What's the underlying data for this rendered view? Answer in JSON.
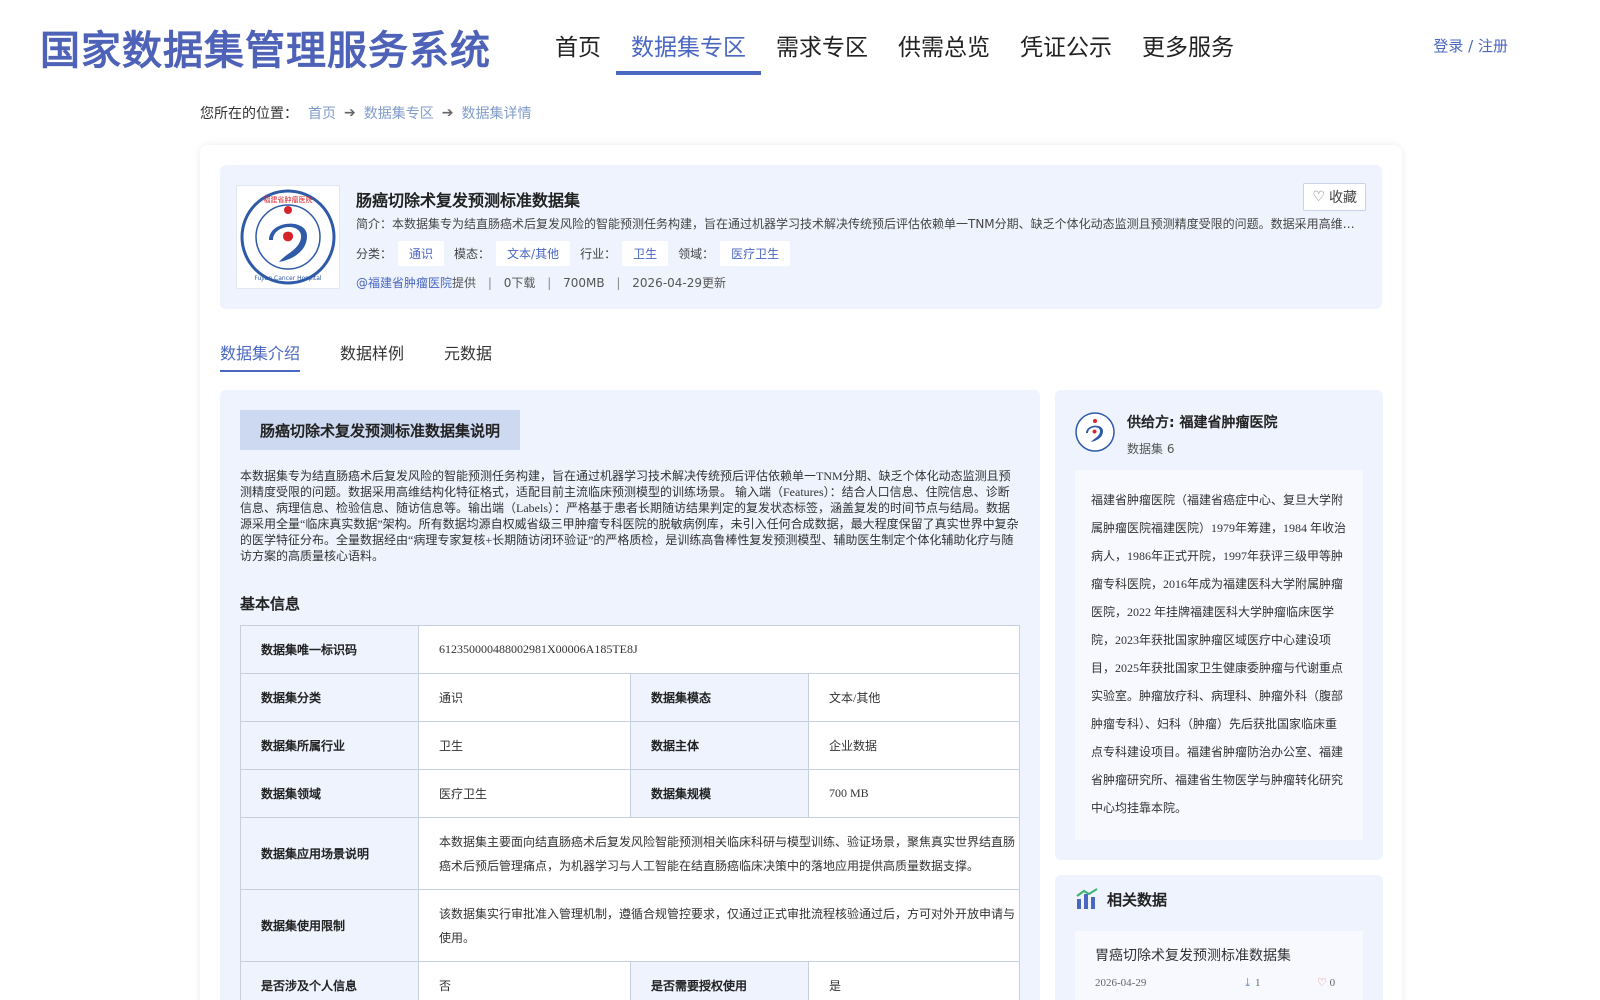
{
  "header": {
    "logo": "国家数据集管理服务系统",
    "nav": [
      "首页",
      "数据集专区",
      "需求专区",
      "供需总览",
      "凭证公示",
      "更多服务"
    ],
    "active_nav": "数据集专区",
    "login": "登录 / 注册"
  },
  "breadcrumb": {
    "label": "您所在的位置：",
    "items": [
      "首页",
      "数据集专区",
      "数据集详情"
    ]
  },
  "dataset": {
    "title": "肠癌切除术复发预测标准数据集",
    "brief": "简介：本数据集专为结直肠癌术后复发风险的智能预测任务构建，旨在通过机器学习技术解决传统预后评估依赖单一TNM分期、缺乏个体化动态监测且预测精度受限的问题。数据采用高维…",
    "favorite": "收藏",
    "tags": {
      "category_label": "分类：",
      "category": "通识",
      "modality_label": "模态：",
      "modality": "文本/其他",
      "industry_label": "行业：",
      "industry": "卫生",
      "domain_label": "领域：",
      "domain": "医疗卫生"
    },
    "meta": {
      "provider": "@福建省肿瘤医院",
      "provider_suffix": "提供",
      "downloads": "0下载",
      "size": "700MB",
      "updated": "2026-04-29更新"
    },
    "logo_text_top": "福建省肿瘤医院",
    "logo_text_bottom": "Fujian Cancer Hospital"
  },
  "tabs": [
    "数据集介绍",
    "数据样例",
    "元数据"
  ],
  "intro": {
    "banner": "肠癌切除术复发预测标准数据集说明",
    "description": "本数据集专为结直肠癌术后复发风险的智能预测任务构建，旨在通过机器学习技术解决传统预后评估依赖单一TNM分期、缺乏个体化动态监测且预测精度受限的问题。数据采用高维结构化特征格式，适配目前主流临床预测模型的训练场景。 输入端（Features）：结合人口信息、住院信息、诊断信息、病理信息、检验信息、随访信息等。输出端（Labels）：严格基于患者长期随访结果判定的复发状态标签，涵盖复发的时间节点与结局。数据源采用全量“临床真实数据”架构。所有数据均源自权威省级三甲肿瘤专科医院的脱敏病例库，未引入任何合成数据，最大程度保留了真实世界中复杂的医学特征分布。全量数据经由“病理专家复核+长期随访闭环验证”的严格质检，是训练高鲁棒性复发预测模型、辅助医生制定个体化辅助化疗与随访方案的高质量核心语料。",
    "basic_title": "基本信息",
    "table": {
      "uid_k": "数据集唯一标识码",
      "uid_v": "612350000488002981X00006A185TE8J",
      "cat_k": "数据集分类",
      "cat_v": "通识",
      "mod_k": "数据集模态",
      "mod_v": "文本/其他",
      "ind_k": "数据集所属行业",
      "ind_v": "卫生",
      "subj_k": "数据主体",
      "subj_v": "企业数据",
      "dom_k": "数据集领域",
      "dom_v": "医疗卫生",
      "scale_k": "数据集规模",
      "scale_v": "700 MB",
      "scene_k": "数据集应用场景说明",
      "scene_v": "本数据集主要面向结直肠癌术后复发风险智能预测相关临床科研与模型训练、验证场景，聚焦真实世界结直肠癌术后预后管理痛点，为机器学习与人工智能在结直肠癌临床决策中的落地应用提供高质量数据支撑。",
      "limit_k": "数据集使用限制",
      "limit_v": "该数据集实行审批准入管理机制，遵循合规管控要求，仅通过正式审批流程核验通过后，方可对外开放申请与使用。",
      "pi_k": "是否涉及个人信息",
      "pi_v": "否",
      "auth_k": "是否需要授权使用",
      "auth_v": "是"
    }
  },
  "supplier": {
    "name": "供给方: 福建省肿瘤医院",
    "count": "数据集 6",
    "intro": "福建省肿瘤医院（福建省癌症中心、复旦大学附属肿瘤医院福建医院）1979年筹建，1984 年收治病人，1986年正式开院，1997年获评三级甲等肿瘤专科医院，2016年成为福建医科大学附属肿瘤医院，2022 年挂牌福建医科大学肿瘤临床医学院，2023年获批国家肿瘤区域医疗中心建设项目，2025年获批国家卫生健康委肿瘤与代谢重点实验室。肿瘤放疗科、病理科、肿瘤外科（腹部肿瘤专科）、妇科（肿瘤）先后获批国家临床重点专科建设项目。福建省肿瘤防治办公室、福建省肿瘤研究所、福建省生物医学与肿瘤转化研究中心均挂靠本院。"
  },
  "related": {
    "title": "相关数据",
    "items": [
      {
        "title": "胃癌切除术复发预测标准数据集",
        "date": "2026-04-29",
        "downloads": "1",
        "likes": "0"
      }
    ]
  },
  "colors": {
    "accent": "#4a67c2",
    "panel": "#eef3fd"
  }
}
